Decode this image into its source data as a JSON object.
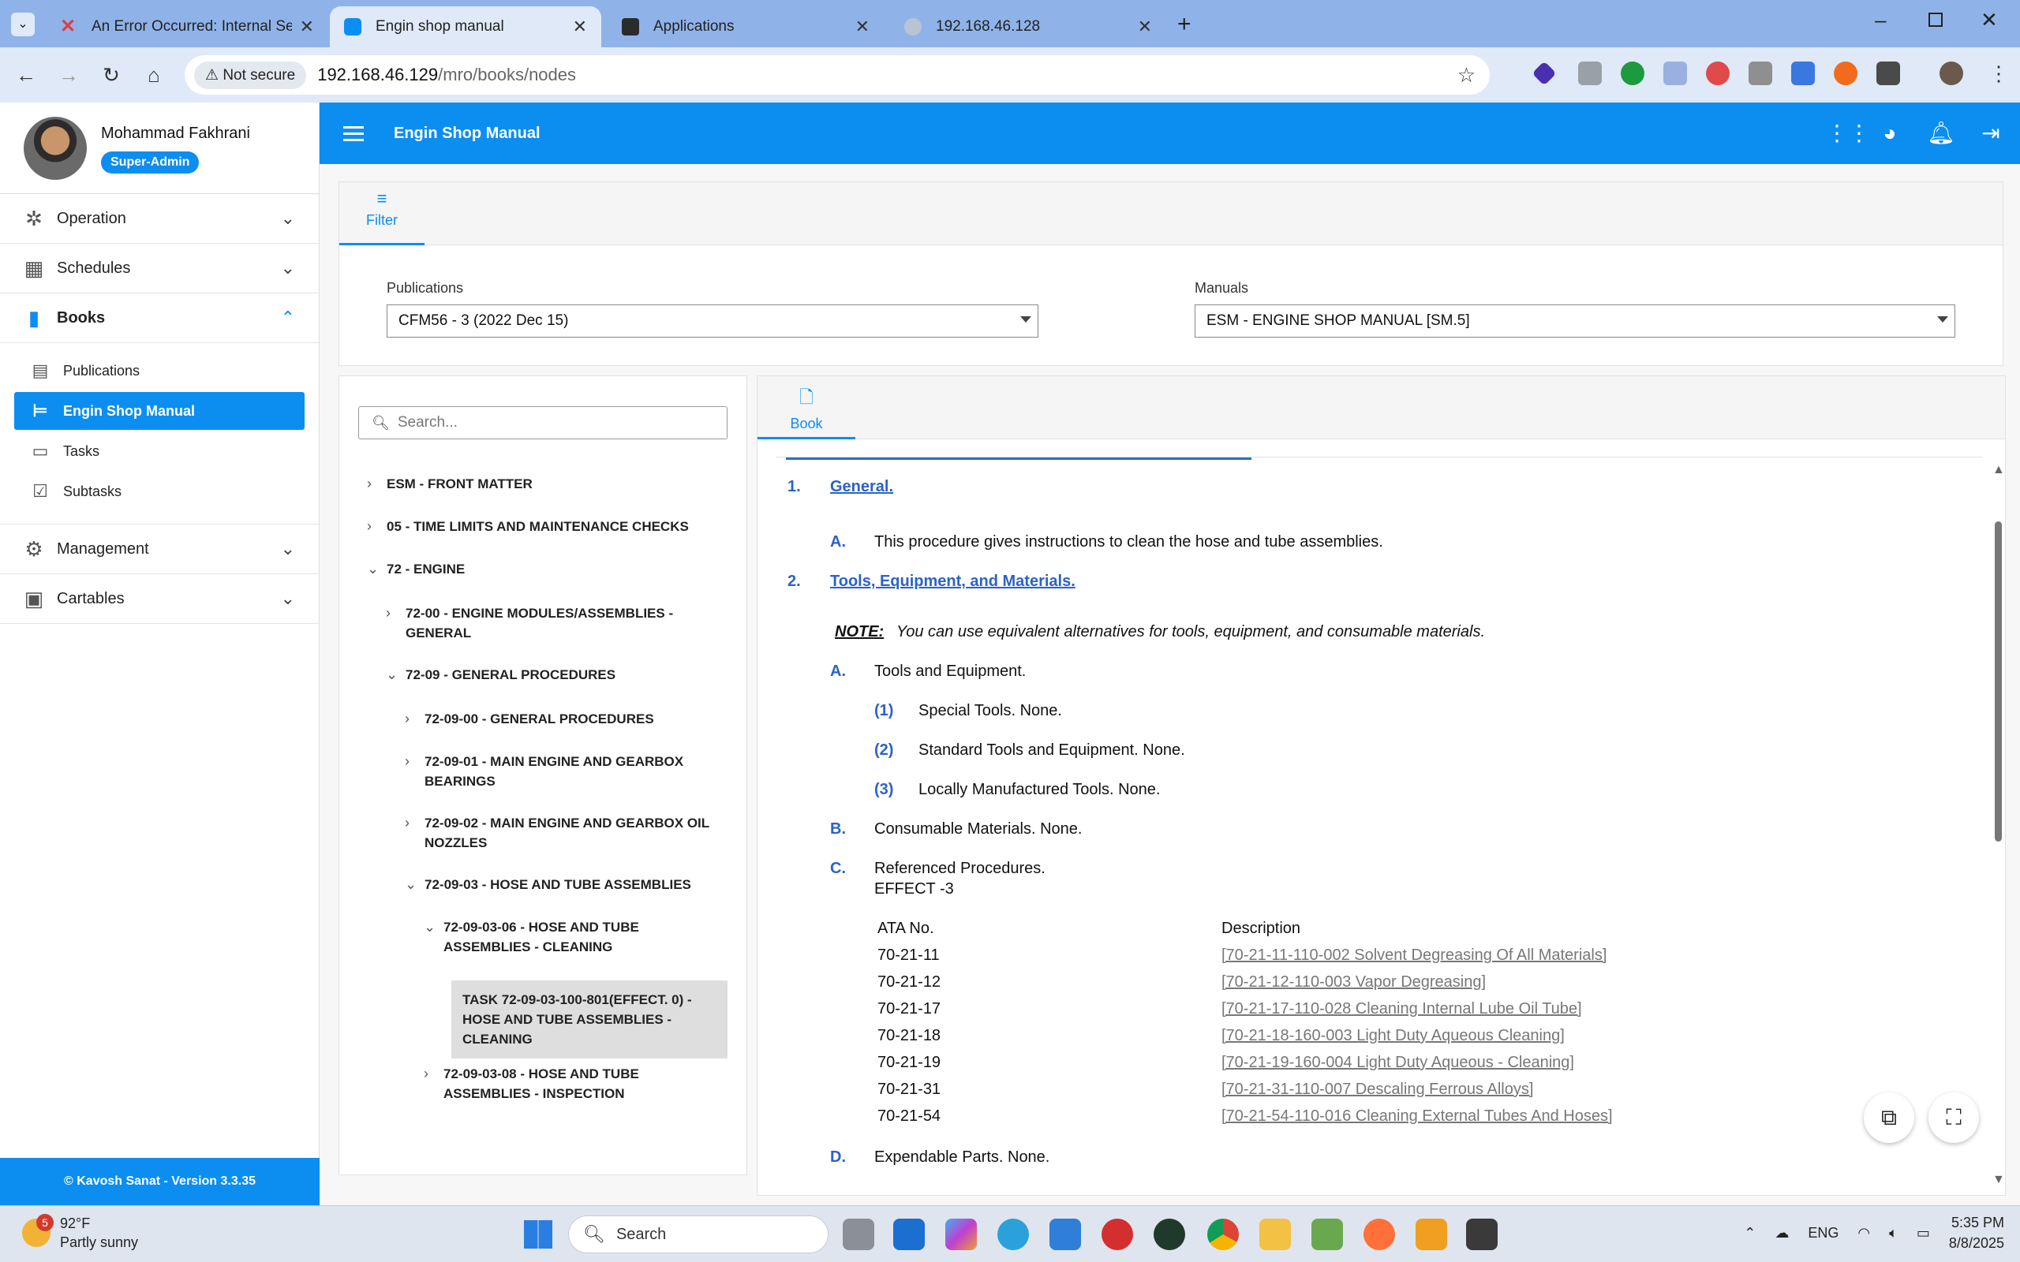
{
  "browser": {
    "tabs": [
      {
        "label": "An Error Occurred: Internal Serv",
        "icon": "error-x-icon"
      },
      {
        "label": "Engin shop manual",
        "icon": "app-favicon-icon"
      },
      {
        "label": "Applications",
        "icon": "figma-icon"
      },
      {
        "label": "192.168.46.128",
        "icon": "globe-icon"
      }
    ],
    "security_label": "Not secure",
    "url_host": "192.168.46.129",
    "url_path": "/mro/books/nodes"
  },
  "app": {
    "title": "Engin Shop Manual",
    "accent_color": "#0b8ef0"
  },
  "user": {
    "name": "Mohammad Fakhrani",
    "role": "Super-Admin"
  },
  "sidebar": {
    "operation": "Operation",
    "schedules": "Schedules",
    "books": "Books",
    "books_sub": {
      "publications": "Publications",
      "engin_shop_manual": "Engin Shop Manual",
      "tasks": "Tasks",
      "subtasks": "Subtasks"
    },
    "management": "Management",
    "cartables": "Cartables",
    "footer": "© Kavosh Sanat - Version 3.3.35"
  },
  "filter": {
    "tab_label": "Filter",
    "publications_label": "Publications",
    "publications_value": "CFM56 - 3 (2022 Dec 15)",
    "manuals_label": "Manuals",
    "manuals_value": "ESM - ENGINE SHOP MANUAL [SM.5]"
  },
  "tree": {
    "search_placeholder": "Search...",
    "nodes": {
      "front_matter": "ESM - FRONT MATTER",
      "time_limits": "05 - TIME LIMITS AND MAINTENANCE CHECKS",
      "engine": "72 - ENGINE",
      "n7200": "72-00 - ENGINE MODULES/ASSEMBLIES - GENERAL",
      "n7209": "72-09 - GENERAL PROCEDURES",
      "n720900": "72-09-00 - GENERAL PROCEDURES",
      "n720901": "72-09-01 - MAIN ENGINE AND GEARBOX BEARINGS",
      "n720902": "72-09-02 - MAIN ENGINE AND GEARBOX OIL NOZZLES",
      "n720903": "72-09-03 - HOSE AND TUBE ASSEMBLIES",
      "n72090306": "72-09-03-06 - HOSE AND TUBE ASSEMBLIES - CLEANING",
      "task": "TASK 72-09-03-100-801(EFFECT. 0) - HOSE AND TUBE ASSEMBLIES - CLEANING",
      "n72090308": "72-09-03-08 - HOSE AND TUBE ASSEMBLIES - INSPECTION"
    }
  },
  "book": {
    "tab_label": "Book",
    "s1_num": "1.",
    "s1_title": "General.",
    "s1a_num": "A.",
    "s1a_text": "This procedure gives instructions to clean the hose and tube assemblies.",
    "s2_num": "2.",
    "s2_title": "Tools, Equipment, and Materials.",
    "note_label": "NOTE:",
    "note_text": "You can use equivalent alternatives for tools, equipment, and consumable materials.",
    "s2a_num": "A.",
    "s2a_text": "Tools and Equipment.",
    "i1_num": "(1)",
    "i1_text": "Special Tools. None.",
    "i2_num": "(2)",
    "i2_text": "Standard Tools and Equipment. None.",
    "i3_num": "(3)",
    "i3_text": "Locally Manufactured Tools. None.",
    "s2b_num": "B.",
    "s2b_text": "Consumable Materials. None.",
    "s2c_num": "C.",
    "s2c_text": "Referenced Procedures.",
    "effect": "EFFECT  -3",
    "col_ata": "ATA No.",
    "col_desc": "Description",
    "refs": [
      {
        "ata": "70-21-11",
        "desc": "[70-21-11-110-002 Solvent Degreasing Of All Materials]"
      },
      {
        "ata": "70-21-12",
        "desc": "[70-21-12-110-003 Vapor Degreasing]"
      },
      {
        "ata": "70-21-17",
        "desc": "[70-21-17-110-028 Cleaning Internal Lube Oil Tube]"
      },
      {
        "ata": "70-21-18",
        "desc": "[70-21-18-160-003 Light Duty Aqueous Cleaning]"
      },
      {
        "ata": "70-21-19",
        "desc": "[70-21-19-160-004 Light Duty Aqueous - Cleaning]"
      },
      {
        "ata": "70-21-31",
        "desc": "[70-21-31-110-007 Descaling Ferrous Alloys]"
      },
      {
        "ata": "70-21-54",
        "desc": "[70-21-54-110-016 Cleaning External Tubes And Hoses]"
      }
    ],
    "s2d_num": "D.",
    "s2d_text": "Expendable Parts. None."
  },
  "taskbar": {
    "weather_badge": "5",
    "temperature": "92°F",
    "weather": "Partly sunny",
    "search_label": "Search",
    "language": "ENG",
    "time": "5:35 PM",
    "date": "8/8/2025"
  }
}
